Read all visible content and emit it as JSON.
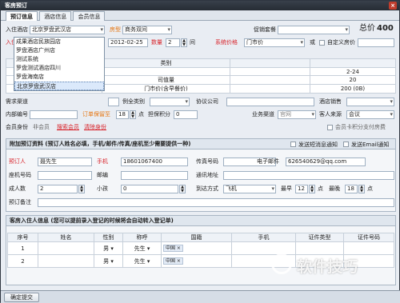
{
  "window": {
    "title": "客房预订",
    "close": "×"
  },
  "tabs": [
    "预订信息",
    "酒店信息",
    "会员信息"
  ],
  "hotel": {
    "label": "入住酒店",
    "value": "北京罗盘武汉店"
  },
  "room_type": {
    "label": "房型",
    "value": "商务双间"
  },
  "promo": {
    "label": "促销套餐",
    "total_label": "总价",
    "total_value": "400"
  },
  "checkin": {
    "label": "入住日期",
    "date": "2012-02-25",
    "qty_label": "数量",
    "qty": "2",
    "unit": "间"
  },
  "price": {
    "label": "系统价格",
    "value": "门市价",
    "or": "或",
    "custom_label": "自定义房价"
  },
  "hotel_options": [
    "成果酒店民族园店",
    "罗盘酒店广州店",
    "测试系统",
    "罗盘测试酒店四川",
    "罗盘海南店",
    "北京罗盘武汉店"
  ],
  "price_table": {
    "header": [
      "",
      "类别",
      "",
      ""
    ],
    "rows": [
      [
        "",
        "",
        "",
        "2-24"
      ],
      [
        "",
        "司值量",
        "",
        "20"
      ],
      [
        "",
        "门市价(含早餐价)",
        "",
        "200 (0B)"
      ]
    ]
  },
  "row_guest": {
    "channel_label": "需求渠道",
    "channel_value": "",
    "sale_label": "例全类别",
    "company_label": "协议公司",
    "sale_right_label": "酒店销售"
  },
  "row_code": {
    "code_label": "内部编号",
    "hold_label": "订单保留至",
    "hold_value": "18",
    "hold_unit": "点",
    "points_label": "担保积分",
    "points_value": "0",
    "channel_label": "业务渠道",
    "channel_value": "官网",
    "source_label": "客人来源",
    "source_value": "会议"
  },
  "row_member": {
    "label": "会员身份",
    "value": "非会员",
    "search": "搜索会员",
    "clear": "清除身份",
    "pay_label": "会员卡积分支付房费"
  },
  "extra": {
    "title": "附加预订资料 (预订人姓名必填，手机/邮件/传真/座机至少需要提供一种)",
    "sms": "发送短消息通知",
    "email": "发送Email通知",
    "booker_label": "预订人",
    "booker_value": "聂先生",
    "mobile_label": "手机",
    "mobile_value": "18601067400",
    "fax_label": "传真号码",
    "email_label": "电子邮件",
    "email_value": "626540629@qq.com",
    "phone_label": "座机号码",
    "mail_label": "邮编",
    "addr_label": "通讯地址",
    "adult_label": "成人数",
    "adult_value": "2",
    "child_label": "小孩",
    "child_value": "0",
    "arrive_label": "到达方式",
    "arrive_value": "飞机",
    "earliest_label": "最早",
    "earliest_value": "12",
    "point1": "点",
    "latest_label": "最晚",
    "latest_value": "18",
    "point2": "点",
    "remark_label": "预订备注"
  },
  "guests": {
    "title": "客房入住人信息 (您可以提前录入登记的时候将会自动转入登记单)",
    "headers": [
      "序号",
      "姓名",
      "性别",
      "称呼",
      "国籍",
      "手机",
      "证件类型",
      "证件号码"
    ],
    "rows": [
      {
        "no": "1",
        "sex": "男",
        "title": "先生",
        "country": "中国"
      },
      {
        "no": "2",
        "sex": "男",
        "title": "先生",
        "country": "中国"
      }
    ]
  },
  "footer": {
    "confirm": "确定提交"
  },
  "watermark": "软件技巧"
}
